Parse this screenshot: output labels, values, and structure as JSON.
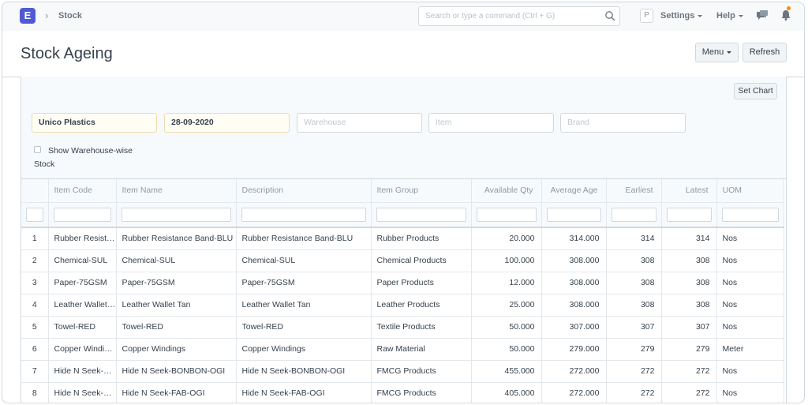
{
  "navbar": {
    "logo_letter": "E",
    "breadcrumb": "Stock",
    "search_placeholder": "Search or type a command (Ctrl + G)",
    "avatar_letter": "P",
    "settings_label": "Settings",
    "help_label": "Help"
  },
  "page": {
    "title": "Stock Ageing",
    "menu_label": "Menu",
    "refresh_label": "Refresh",
    "set_chart_label": "Set Chart"
  },
  "filters": {
    "company": "Unico Plastics",
    "date": "28-09-2020",
    "warehouse_placeholder": "Warehouse",
    "item_placeholder": "Item",
    "brand_placeholder": "Brand",
    "checkbox_label": "Show Warehouse-wise Stock"
  },
  "table": {
    "columns": [
      "Item Code",
      "Item Name",
      "Description",
      "Item Group",
      "Available Qty",
      "Average Age",
      "Earliest",
      "Latest",
      "UOM"
    ],
    "rows": [
      {
        "idx": "1",
        "code": "Rubber Resistance Band-BLU",
        "name": "Rubber Resistance Band-BLU",
        "desc": "Rubber Resistance Band-BLU",
        "group": "Rubber Products",
        "qty": "20.000",
        "avg": "314.000",
        "earliest": "314",
        "latest": "314",
        "uom": "Nos"
      },
      {
        "idx": "2",
        "code": "Chemical-SUL",
        "name": "Chemical-SUL",
        "desc": "Chemical-SUL",
        "group": "Chemical Products",
        "qty": "100.000",
        "avg": "308.000",
        "earliest": "308",
        "latest": "308",
        "uom": "Nos"
      },
      {
        "idx": "3",
        "code": "Paper-75GSM",
        "name": "Paper-75GSM",
        "desc": "Paper-75GSM",
        "group": "Paper Products",
        "qty": "12.000",
        "avg": "308.000",
        "earliest": "308",
        "latest": "308",
        "uom": "Nos"
      },
      {
        "idx": "4",
        "code": "Leather Wallet Tan",
        "name": "Leather Wallet Tan",
        "desc": "Leather Wallet Tan",
        "group": "Leather Products",
        "qty": "25.000",
        "avg": "308.000",
        "earliest": "308",
        "latest": "308",
        "uom": "Nos"
      },
      {
        "idx": "5",
        "code": "Towel-RED",
        "name": "Towel-RED",
        "desc": "Towel-RED",
        "group": "Textile Products",
        "qty": "50.000",
        "avg": "307.000",
        "earliest": "307",
        "latest": "307",
        "uom": "Nos"
      },
      {
        "idx": "6",
        "code": "Copper Windings",
        "name": "Copper Windings",
        "desc": "Copper Windings",
        "group": "Raw Material",
        "qty": "50.000",
        "avg": "279.000",
        "earliest": "279",
        "latest": "279",
        "uom": "Meter"
      },
      {
        "idx": "7",
        "code": "Hide N Seek-BONBON-OGI",
        "name": "Hide N Seek-BONBON-OGI",
        "desc": "Hide N Seek-BONBON-OGI",
        "group": "FMCG Products",
        "qty": "455.000",
        "avg": "272.000",
        "earliest": "272",
        "latest": "272",
        "uom": "Nos"
      },
      {
        "idx": "8",
        "code": "Hide N Seek-FAB-OGI",
        "name": "Hide N Seek-FAB-OGI",
        "desc": "Hide N Seek-FAB-OGI",
        "group": "FMCG Products",
        "qty": "405.000",
        "avg": "272.000",
        "earliest": "272",
        "latest": "272",
        "uom": "Nos"
      }
    ]
  }
}
